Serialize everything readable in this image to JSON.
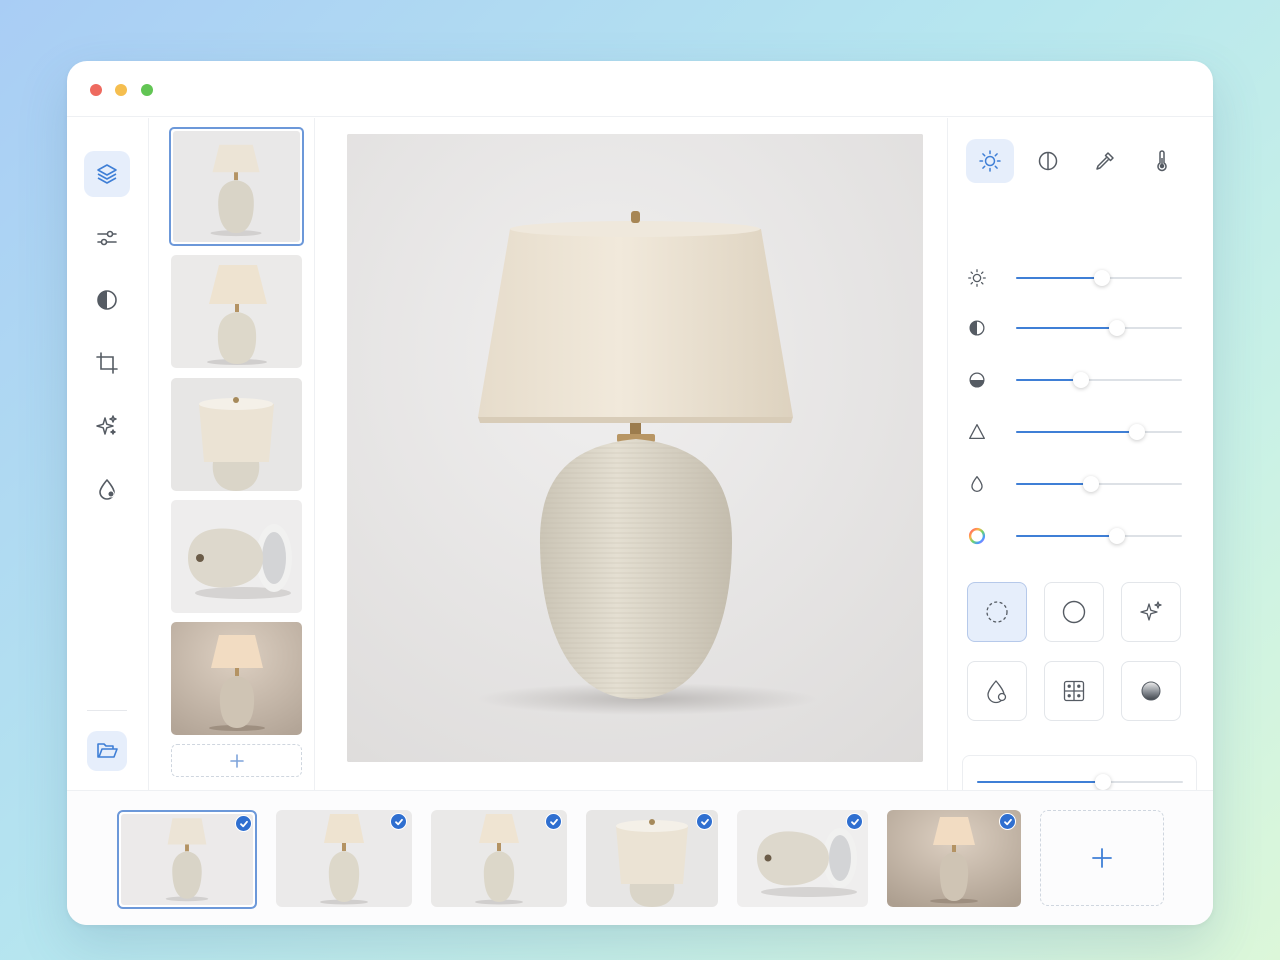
{
  "window": {
    "traffic_lights": {
      "close": "#ee6a5f",
      "minimize": "#f5be4f",
      "maximize": "#62c554"
    }
  },
  "toolbar": {
    "items": [
      {
        "icon": "layers-icon",
        "active": true
      },
      {
        "icon": "sliders-icon",
        "active": false
      },
      {
        "icon": "contrast-icon",
        "active": false
      },
      {
        "icon": "crop-icon",
        "active": false
      },
      {
        "icon": "sparkles-icon",
        "active": false
      },
      {
        "icon": "droplet-icon",
        "active": false
      }
    ],
    "bottom": {
      "icon": "folder-open-icon"
    }
  },
  "thumbnails": {
    "items": [
      {
        "name": "lamp-front-white",
        "selected": true
      },
      {
        "name": "lamp-front-light",
        "selected": false
      },
      {
        "name": "lamp-closeup-top",
        "selected": false
      },
      {
        "name": "lamp-lying-side",
        "selected": false
      },
      {
        "name": "lamp-warm-lit",
        "selected": false
      }
    ],
    "add_icon": "plus-icon"
  },
  "adjust_panel": {
    "tabs": [
      {
        "icon": "sun-icon",
        "active": true
      },
      {
        "icon": "half-circle-icon",
        "active": false
      },
      {
        "icon": "eyedropper-icon",
        "active": false
      },
      {
        "icon": "thermometer-icon",
        "active": false
      }
    ],
    "sliders": [
      {
        "icon": "brightness-icon",
        "value": 0.52
      },
      {
        "icon": "contrast-icon",
        "value": 0.61
      },
      {
        "icon": "shadows-icon",
        "value": 0.39
      },
      {
        "icon": "sharpness-icon",
        "value": 0.73
      },
      {
        "icon": "saturation-icon",
        "value": 0.45
      },
      {
        "icon": "hue-icon",
        "value": 0.61
      }
    ],
    "filters": [
      {
        "icon": "dashed-circle-icon",
        "active": true
      },
      {
        "icon": "circle-icon",
        "active": false
      },
      {
        "icon": "sparkle-icon",
        "active": false
      },
      {
        "icon": "tint-icon",
        "active": false
      },
      {
        "icon": "grid-icon",
        "active": false
      },
      {
        "icon": "gradient-sphere-icon",
        "active": false
      }
    ],
    "fine_tune": {
      "value": 0.61
    }
  },
  "filmstrip": {
    "items": [
      {
        "name": "lamp-front-white",
        "selected": true,
        "checked": true
      },
      {
        "name": "lamp-front-light",
        "selected": false,
        "checked": true
      },
      {
        "name": "lamp-front-light-2",
        "selected": false,
        "checked": true
      },
      {
        "name": "lamp-closeup-top",
        "selected": false,
        "checked": true
      },
      {
        "name": "lamp-lying-side",
        "selected": false,
        "checked": true
      },
      {
        "name": "lamp-warm-lit",
        "selected": false,
        "checked": true
      }
    ],
    "add_icon": "plus-icon"
  },
  "colors": {
    "accent": "#3f7fd6",
    "active_bg": "#e6eefb",
    "selected_border": "#6c98d9"
  }
}
